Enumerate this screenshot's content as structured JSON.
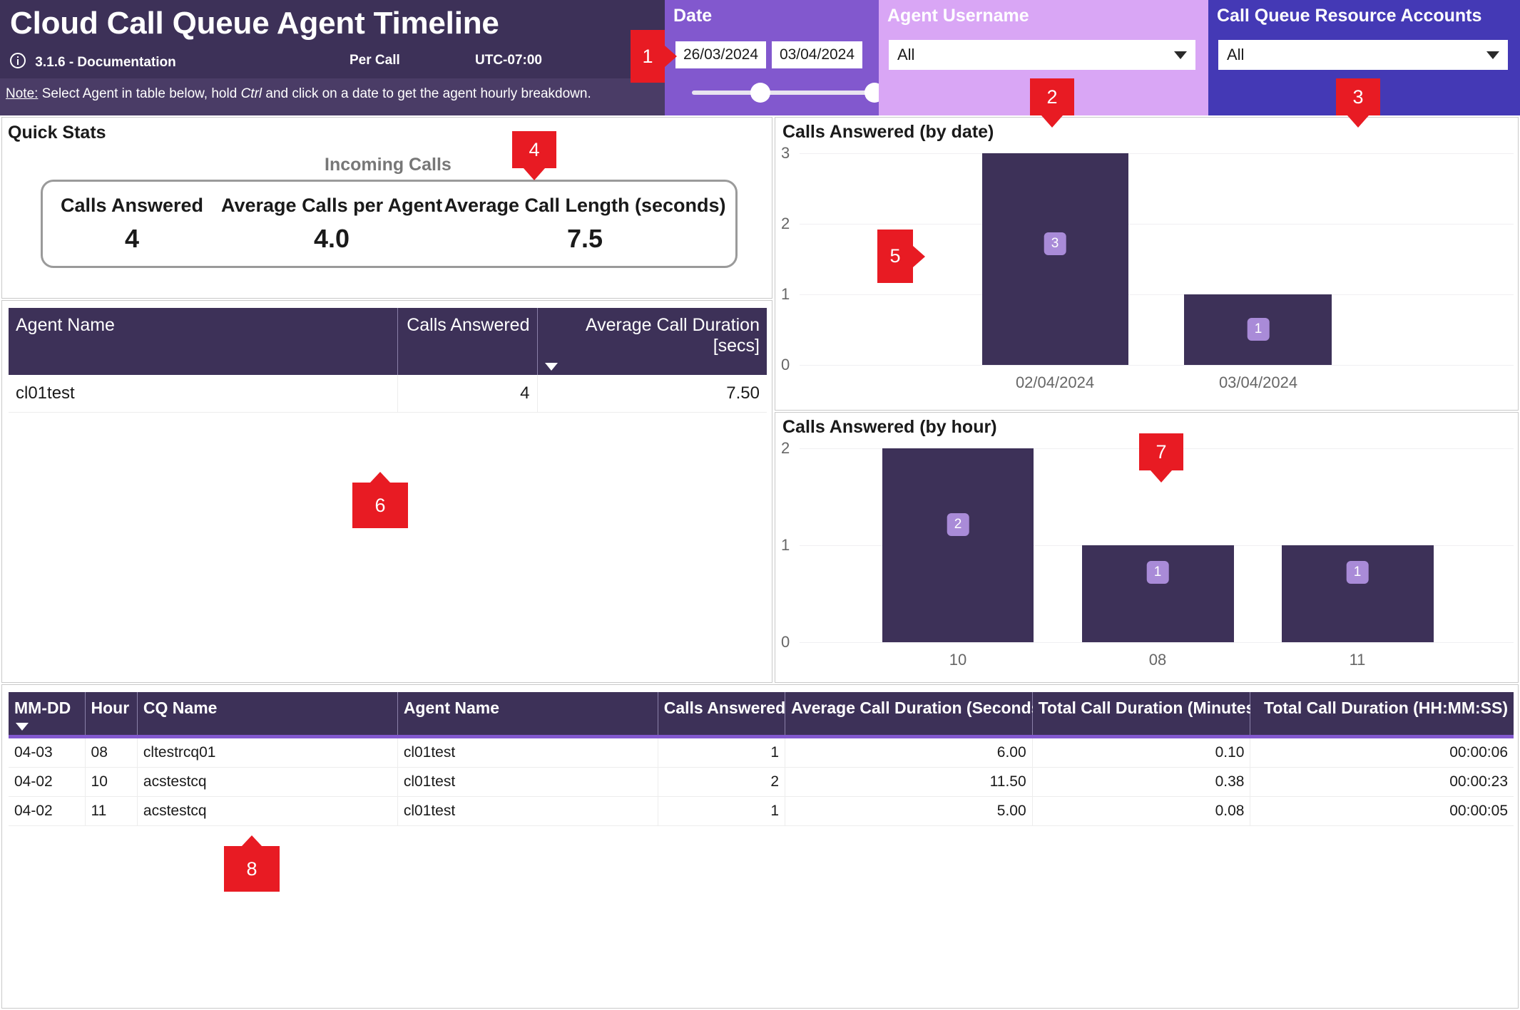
{
  "header": {
    "title": "Cloud Call Queue Agent Timeline",
    "version_doc": "3.1.6 - Documentation",
    "per_call": "Per Call",
    "timezone": "UTC-07:00",
    "note_prefix": "Note:",
    "note_part1": " Select Agent in table below, hold ",
    "note_italic": "Ctrl",
    "note_part2": " and click on a date to get the agent hourly breakdown."
  },
  "slicers": {
    "date": {
      "title": "Date",
      "start": "26/03/2024",
      "end": "03/04/2024"
    },
    "agent_username": {
      "title": "Agent Username",
      "value": "All"
    },
    "call_queue_resource_accounts": {
      "title": "Call Queue Resource Accounts",
      "value": "All"
    }
  },
  "markers": [
    {
      "id": "1",
      "label": "1"
    },
    {
      "id": "2",
      "label": "2"
    },
    {
      "id": "3",
      "label": "3"
    },
    {
      "id": "4",
      "label": "4"
    },
    {
      "id": "5",
      "label": "5"
    },
    {
      "id": "6",
      "label": "6"
    },
    {
      "id": "7",
      "label": "7"
    },
    {
      "id": "8",
      "label": "8"
    }
  ],
  "quick_stats": {
    "title": "Quick Stats",
    "subtitle": "Incoming Calls",
    "kpis": [
      {
        "label": "Calls Answered",
        "value": "4"
      },
      {
        "label": "Average Calls per Agent",
        "value": "4.0"
      },
      {
        "label": "Average Call Length (seconds)",
        "value": "7.5"
      }
    ]
  },
  "agent_table": {
    "columns": [
      "Agent Name",
      "Calls Answered",
      "Average Call Duration [secs]"
    ],
    "sorted_column_index": 2,
    "rows": [
      {
        "agent_name": "cl01test",
        "calls_answered": "4",
        "avg_call_duration": "7.50"
      }
    ]
  },
  "detail_table": {
    "columns": [
      "MM-DD",
      "Hour",
      "CQ Name",
      "Agent Name",
      "Calls Answered",
      "Average Call Duration (Seconds)",
      "Total Call Duration (Minutes)",
      "Total Call Duration (HH:MM:SS)"
    ],
    "sorted_column_index": 0,
    "rows": [
      {
        "mmdd": "04-03",
        "hour": "08",
        "cq_name": "cltestrcq01",
        "agent_name": "cl01test",
        "calls_answered": "1",
        "avg_dur_sec": "6.00",
        "total_dur_min": "0.10",
        "total_dur_hms": "00:00:06"
      },
      {
        "mmdd": "04-02",
        "hour": "10",
        "cq_name": "acstestcq",
        "agent_name": "cl01test",
        "calls_answered": "2",
        "avg_dur_sec": "11.50",
        "total_dur_min": "0.38",
        "total_dur_hms": "00:00:23"
      },
      {
        "mmdd": "04-02",
        "hour": "11",
        "cq_name": "acstestcq",
        "agent_name": "cl01test",
        "calls_answered": "1",
        "avg_dur_sec": "5.00",
        "total_dur_min": "0.08",
        "total_dur_hms": "00:00:05"
      }
    ]
  },
  "chart_data": [
    {
      "type": "bar",
      "title": "Calls Answered (by date)",
      "categories": [
        "02/04/2024",
        "03/04/2024"
      ],
      "values": [
        3,
        1
      ],
      "data_labels": [
        "3",
        "1"
      ],
      "xlabel": "",
      "ylabel": "",
      "ylim": [
        0,
        3
      ],
      "yticks": [
        0,
        1,
        2,
        3
      ],
      "grid": true,
      "legend": "none",
      "bar_color": "#3D3158",
      "label_badge_color": "#A98BD8"
    },
    {
      "type": "bar",
      "title": "Calls Answered (by hour)",
      "categories": [
        "10",
        "08",
        "11"
      ],
      "values": [
        2,
        1,
        1
      ],
      "data_labels": [
        "2",
        "1",
        "1"
      ],
      "xlabel": "",
      "ylabel": "",
      "ylim": [
        0,
        2
      ],
      "yticks": [
        0,
        1,
        2
      ],
      "grid": true,
      "legend": "none",
      "bar_color": "#3D3158",
      "label_badge_color": "#A98BD8"
    }
  ],
  "colors": {
    "header_bg": "#3D3158",
    "note_bg": "#4A3C66",
    "date_slicer_bg": "#8258CE",
    "agent_slicer_bg": "#D9A6F5",
    "cq_slicer_bg": "#4439B5",
    "marker_red": "#E81B23",
    "accent_purple": "#8258CE"
  }
}
